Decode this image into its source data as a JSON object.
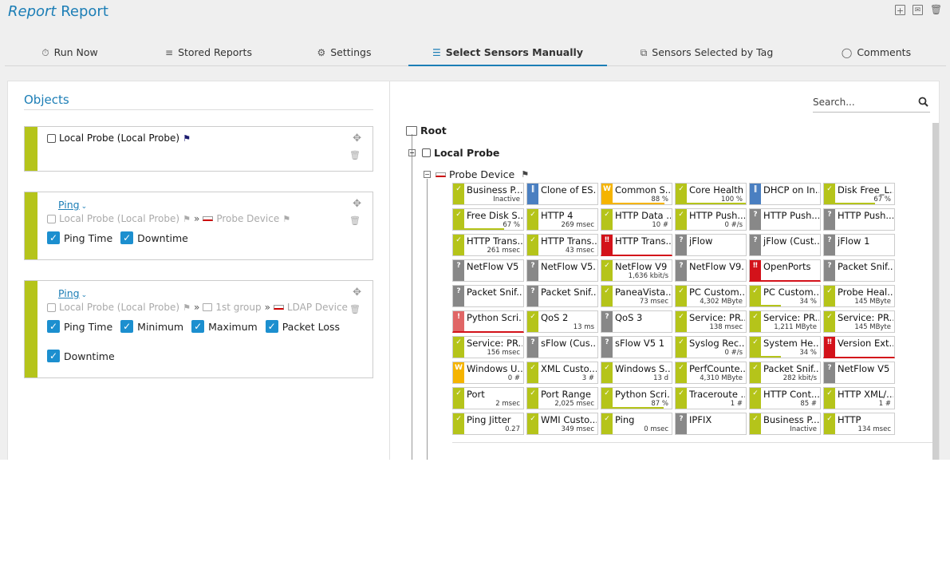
{
  "header": {
    "title_part1": "Report",
    "title_part2": "Report",
    "actions": [
      {
        "icon": "add-page-icon"
      },
      {
        "icon": "email-icon"
      },
      {
        "icon": "trash-icon"
      }
    ]
  },
  "tabs": [
    {
      "label": "Run Now",
      "icon": "stopwatch-icon"
    },
    {
      "label": "Stored Reports",
      "icon": "database-icon"
    },
    {
      "label": "Settings",
      "icon": "gear-icon"
    },
    {
      "label": "Select Sensors Manually",
      "icon": "sliders-icon",
      "active": true
    },
    {
      "label": "Sensors Selected by Tag",
      "icon": "tags-icon"
    },
    {
      "label": "Comments",
      "icon": "comment-icon"
    }
  ],
  "objects": {
    "title": "Objects",
    "item1": {
      "label": "Local Probe (Local Probe)"
    },
    "item2": {
      "link": "Ping",
      "path_probe": "Local Probe (Local Probe)",
      "path_sep": "»",
      "path_device": "Probe Device",
      "options": [
        "Ping Time",
        "Downtime"
      ]
    },
    "item3": {
      "link": "Ping",
      "path_probe": "Local Probe (Local Probe)",
      "path_sep": "»",
      "path_group": "1st group",
      "path_device": "LDAP Device",
      "options": [
        "Ping Time",
        "Minimum",
        "Maximum",
        "Packet Loss"
      ],
      "options2": [
        "Downtime"
      ]
    }
  },
  "search": {
    "placeholder": "Search..."
  },
  "tree": {
    "root": "Root",
    "probe": "Local Probe",
    "device": "Probe Device"
  },
  "status_colors": {
    "ok": "#b5c41a",
    "warning": "#f5b400",
    "down": "#d3121a",
    "unknown": "#888888",
    "paused": "#4a7fc1"
  },
  "sensors": [
    {
      "name": "Business P...",
      "value": "Inactive",
      "status": "ok"
    },
    {
      "name": "Clone of ES...",
      "value": "",
      "status": "paused"
    },
    {
      "name": "Common S...",
      "value": "88 %",
      "status": "warning",
      "gauge": 0.88
    },
    {
      "name": "Core Health",
      "value": "100 %",
      "status": "ok",
      "gauge": 1.0
    },
    {
      "name": "DHCP on In...",
      "value": "",
      "status": "paused"
    },
    {
      "name": "Disk Free_L...",
      "value": "67 %",
      "status": "ok",
      "gauge": 0.67
    },
    {
      "name": "Free Disk S...",
      "value": "67 %",
      "status": "ok",
      "gauge": 0.67
    },
    {
      "name": "HTTP 4",
      "value": "269 msec",
      "status": "ok"
    },
    {
      "name": "HTTP Data ...",
      "value": "10 #",
      "status": "ok"
    },
    {
      "name": "HTTP Push...",
      "value": "0 #/s",
      "status": "ok"
    },
    {
      "name": "HTTP Push...",
      "value": "",
      "status": "unknown"
    },
    {
      "name": "HTTP Push...",
      "value": "",
      "status": "unknown"
    },
    {
      "name": "HTTP Trans...",
      "value": "261 msec",
      "status": "ok"
    },
    {
      "name": "HTTP Trans...",
      "value": "43 msec",
      "status": "ok"
    },
    {
      "name": "HTTP Trans...",
      "value": "",
      "status": "down"
    },
    {
      "name": "jFlow",
      "value": "",
      "status": "unknown"
    },
    {
      "name": "jFlow (Cust...",
      "value": "",
      "status": "unknown"
    },
    {
      "name": "jFlow 1",
      "value": "",
      "status": "unknown"
    },
    {
      "name": "NetFlow V5",
      "value": "",
      "status": "unknown"
    },
    {
      "name": "NetFlow V5...",
      "value": "",
      "status": "unknown"
    },
    {
      "name": "NetFlow V9",
      "value": "1,636 kbit/s",
      "status": "ok"
    },
    {
      "name": "NetFlow V9...",
      "value": "",
      "status": "unknown"
    },
    {
      "name": "OpenPorts",
      "value": "",
      "status": "down"
    },
    {
      "name": "Packet Snif...",
      "value": "",
      "status": "unknown"
    },
    {
      "name": "Packet Snif...",
      "value": "",
      "status": "unknown"
    },
    {
      "name": "Packet Snif...",
      "value": "",
      "status": "unknown"
    },
    {
      "name": "PaneaVista...",
      "value": "73 msec",
      "status": "ok"
    },
    {
      "name": "PC Custom...",
      "value": "4,302 MByte",
      "status": "ok"
    },
    {
      "name": "PC Custom...",
      "value": "34 %",
      "status": "ok",
      "gauge": 0.34
    },
    {
      "name": "Probe Heal...",
      "value": "145 MByte",
      "status": "ok"
    },
    {
      "name": "Python Scri...",
      "value": "",
      "status": "down-unknown"
    },
    {
      "name": "QoS 2",
      "value": "13 ms",
      "status": "ok"
    },
    {
      "name": "QoS 3",
      "value": "",
      "status": "unknown"
    },
    {
      "name": "Service: PR...",
      "value": "138 msec",
      "status": "ok"
    },
    {
      "name": "Service: PR...",
      "value": "1,211 MByte",
      "status": "ok"
    },
    {
      "name": "Service: PR...",
      "value": "145 MByte",
      "status": "ok"
    },
    {
      "name": "Service: PR...",
      "value": "156 msec",
      "status": "ok"
    },
    {
      "name": "sFlow (Cus...",
      "value": "",
      "status": "unknown"
    },
    {
      "name": "sFlow V5 1",
      "value": "",
      "status": "unknown"
    },
    {
      "name": "Syslog Rec...",
      "value": "0 #/s",
      "status": "ok"
    },
    {
      "name": "System He...",
      "value": "34 %",
      "status": "ok",
      "gauge": 0.34
    },
    {
      "name": "Version Ext...",
      "value": "",
      "status": "down"
    },
    {
      "name": "Windows U...",
      "value": "0 #",
      "status": "warning"
    },
    {
      "name": "XML Custo...",
      "value": "3 #",
      "status": "ok"
    },
    {
      "name": "Windows S...",
      "value": "13 d",
      "status": "ok"
    },
    {
      "name": "PerfCounte...",
      "value": "4,310 MByte",
      "status": "ok"
    },
    {
      "name": "Packet Snif...",
      "value": "282 kbit/s",
      "status": "ok"
    },
    {
      "name": "NetFlow V5",
      "value": "",
      "status": "unknown"
    },
    {
      "name": "Port",
      "value": "2 msec",
      "status": "ok"
    },
    {
      "name": "Port Range",
      "value": "2,025 msec",
      "status": "ok"
    },
    {
      "name": "Python Scri...",
      "value": "87 %",
      "status": "ok",
      "gauge": 0.87
    },
    {
      "name": "Traceroute ...",
      "value": "1 #",
      "status": "ok"
    },
    {
      "name": "HTTP Cont...",
      "value": "85 #",
      "status": "ok"
    },
    {
      "name": "HTTP XML/...",
      "value": "1 #",
      "status": "ok"
    },
    {
      "name": "Ping Jitter",
      "value": "0.27",
      "status": "ok"
    },
    {
      "name": "WMI Custo...",
      "value": "349 msec",
      "status": "ok"
    },
    {
      "name": "Ping",
      "value": "0 msec",
      "status": "ok"
    },
    {
      "name": "IPFIX",
      "value": "",
      "status": "unknown"
    },
    {
      "name": "Business P...",
      "value": "Inactive",
      "status": "ok"
    },
    {
      "name": "HTTP",
      "value": "134 msec",
      "status": "ok"
    }
  ]
}
